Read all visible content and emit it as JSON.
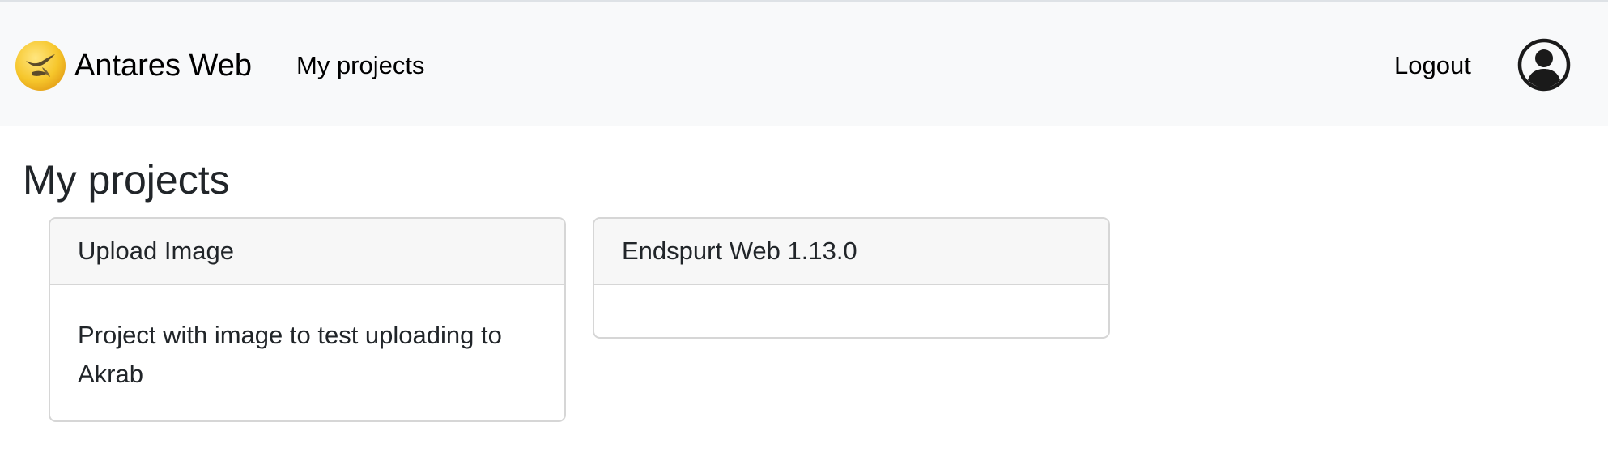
{
  "navbar": {
    "brand_name": "Antares Web",
    "links": {
      "my_projects": "My projects",
      "logout": "Logout"
    },
    "account_icon": "user-circle-icon",
    "logo_icon": "antares-logo-icon",
    "background": "#f8f9fa"
  },
  "page": {
    "title": "My projects"
  },
  "projects": [
    {
      "name": "Upload Image",
      "description": "Project with image to test uploading to Akrab"
    },
    {
      "name": "Endspurt Web 1.13.0",
      "description": ""
    }
  ],
  "colors": {
    "logo_yellow": "#f6c62b",
    "card_border": "#d6d6d6",
    "card_header_bg": "#f7f7f7"
  }
}
